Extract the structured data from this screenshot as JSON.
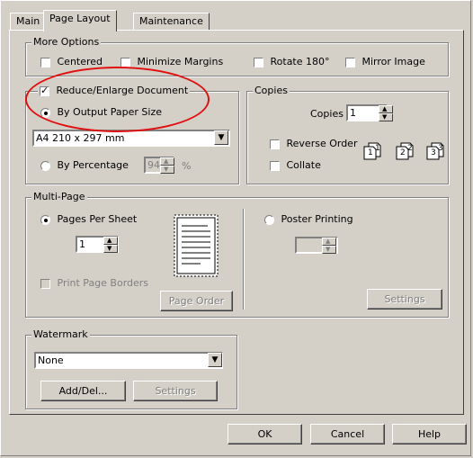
{
  "tabs": [
    {
      "label": "Main"
    },
    {
      "label": "Page Layout"
    },
    {
      "label": "Maintenance"
    }
  ],
  "more_options": {
    "title": "More Options",
    "centered": "Centered",
    "minimize_margins": "Minimize Margins",
    "rotate_180": "Rotate 180°",
    "mirror_image": "Mirror Image"
  },
  "reduce_enlarge": {
    "label": "Reduce/Enlarge Document",
    "by_output_paper_size": "By Output Paper Size",
    "paper_size_value": "A4 210 x 297 mm",
    "by_percentage": "By Percentage",
    "percentage_value": "94",
    "percent_sign": "%"
  },
  "copies": {
    "title": "Copies",
    "copies_label": "Copies",
    "copies_value": "1",
    "reverse_order": "Reverse Order",
    "collate": "Collate",
    "collate_pages": [
      "1",
      "1",
      "2",
      "2",
      "3",
      "3"
    ]
  },
  "multi_page": {
    "title": "Multi-Page",
    "pages_per_sheet": "Pages Per Sheet",
    "pages_value": "1",
    "print_page_borders": "Print Page Borders",
    "page_order": "Page Order",
    "poster_printing": "Poster Printing",
    "settings": "Settings"
  },
  "watermark": {
    "title": "Watermark",
    "value": "None",
    "add_del": "Add/Del...",
    "settings": "Settings"
  },
  "footer": {
    "ok": "OK",
    "cancel": "Cancel",
    "help": "Help"
  },
  "colors": {
    "dialog_bg": "#d4d0c8",
    "highlight_ellipse": "#e01010"
  }
}
